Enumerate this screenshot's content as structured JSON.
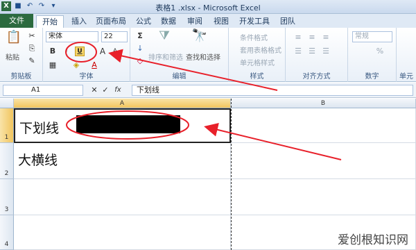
{
  "window": {
    "title": "表格1 .xlsx - Microsoft Excel"
  },
  "tabs": [
    "文件",
    "开始",
    "插入",
    "页面布局",
    "公式",
    "数据",
    "审阅",
    "视图",
    "开发工具",
    "团队"
  ],
  "ribbon": {
    "clipboard": {
      "label": "剪贴板",
      "paste": "粘贴"
    },
    "font": {
      "label": "字体",
      "name": "宋体",
      "size": "22",
      "bold": "B",
      "italic": "I",
      "underline": "U",
      "grow": "A",
      "shrink": "A",
      "color": "A"
    },
    "editing": {
      "label": "编辑",
      "sort": "排序和筛选",
      "find": "查找和选择",
      "sum": "Σ"
    },
    "styles": {
      "label": "样式",
      "cond": "条件格式",
      "table": "套用表格格式",
      "cell": "单元格样式"
    },
    "alignment": {
      "label": "对齐方式"
    },
    "number": {
      "label": "数字",
      "format": "常规",
      "percent": "%"
    },
    "cells": {
      "label": "单元"
    }
  },
  "formula_bar": {
    "name_box": "A1",
    "fx": "fx",
    "content": "下划线"
  },
  "sheet": {
    "columns": [
      "A",
      "B"
    ],
    "rows": [
      {
        "num": "1",
        "a": "下划线"
      },
      {
        "num": "2",
        "a": "大横线"
      },
      {
        "num": "3",
        "a": ""
      },
      {
        "num": "4",
        "a": ""
      }
    ]
  },
  "watermark": "爱创根知识网",
  "annotation_color": "#e8202a"
}
